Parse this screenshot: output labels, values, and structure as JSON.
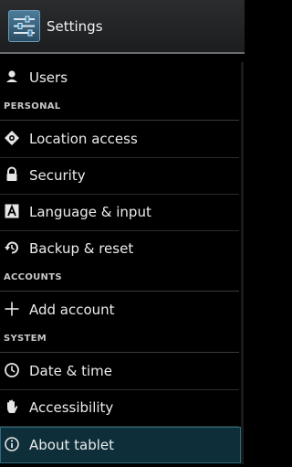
{
  "header": {
    "title": "Settings",
    "icon": "settings-sliders-icon"
  },
  "items": {
    "users": {
      "label": "Users",
      "icon": "user-icon"
    },
    "location": {
      "label": "Location access",
      "icon": "location-target-icon"
    },
    "security": {
      "label": "Security",
      "icon": "lock-icon"
    },
    "language": {
      "label": "Language & input",
      "icon": "keyboard-a-icon"
    },
    "backup": {
      "label": "Backup & reset",
      "icon": "restore-icon"
    },
    "add_account": {
      "label": "Add account",
      "icon": "plus-icon"
    },
    "date_time": {
      "label": "Date & time",
      "icon": "clock-icon"
    },
    "accessibility": {
      "label": "Accessibility",
      "icon": "hand-icon"
    },
    "about": {
      "label": "About tablet",
      "icon": "info-icon",
      "selected": true
    }
  },
  "sections": {
    "personal": "PERSONAL",
    "accounts": "ACCOUNTS",
    "system": "SYSTEM"
  },
  "colors": {
    "background": "#000000",
    "selected_row": "#0e2f3a",
    "accent": "#2a6b80"
  }
}
